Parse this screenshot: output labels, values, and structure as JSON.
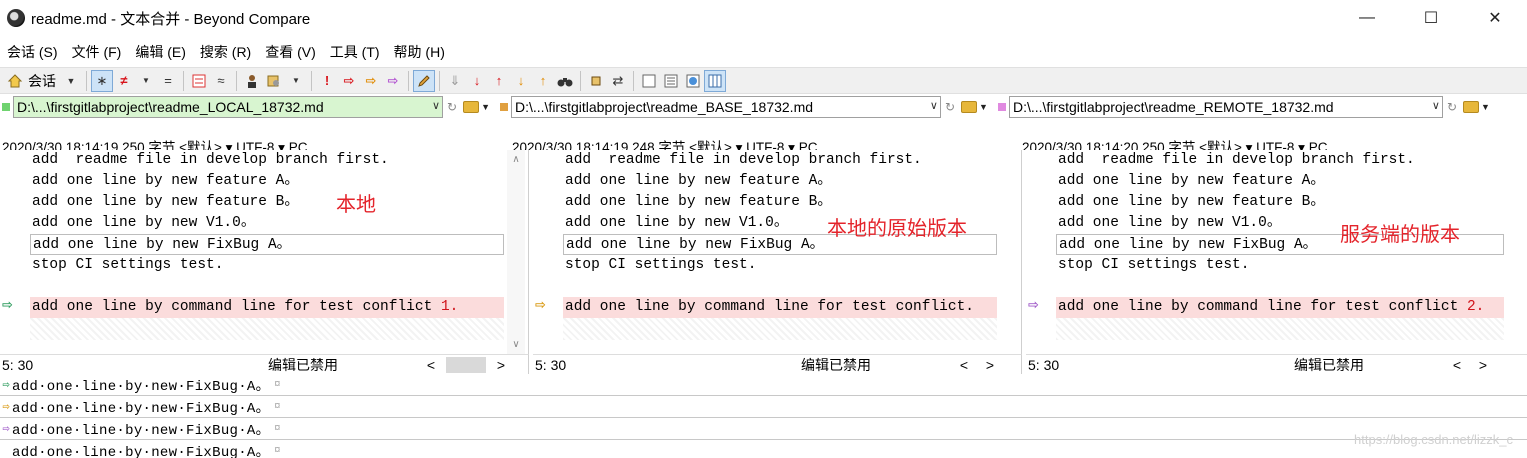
{
  "window": {
    "title": "readme.md - 文本合并 - Beyond Compare",
    "controls": {
      "minimize": "—",
      "maximize": "☐",
      "close": "✕"
    }
  },
  "menu": {
    "items": [
      "会话 (S)",
      "文件 (F)",
      "编辑 (E)",
      "搜索 (R)",
      "查看 (V)",
      "工具 (T)",
      "帮助 (H)"
    ]
  },
  "toolbar": {
    "session_label": "会话",
    "icons": {
      "all": "∗",
      "diffs": "≠",
      "same": "=",
      "context": "≈",
      "prev_conflict": "!",
      "next": "⇒",
      "swap": "⇄",
      "find": "🔍"
    }
  },
  "panes": [
    {
      "id": "local",
      "path": "D:\\...\\firstgitlabproject\\readme_LOCAL_18732.md",
      "path_bg": "#d8f5d0",
      "marker_color": "#6fd36f",
      "info": "2020/3/30 18:14:19   250 字节   <默认> ▾  UTF-8 ▾  PC",
      "annotation": "本地",
      "arrow_color": "#2f9d5f",
      "lines": [
        "add  readme file in develop branch first.",
        "add one line by new feature A。",
        "add one line by new feature B。",
        "add one line by new V1.0。",
        "add one line by new FixBug A。",
        "stop CI settings test.",
        ""
      ],
      "conflict_line": "add one line by command line for test conflict ",
      "conflict_suffix": "1.",
      "status_pos": "5: 30",
      "status_edit": "编辑已禁用"
    },
    {
      "id": "base",
      "path": "D:\\...\\firstgitlabproject\\readme_BASE_18732.md",
      "path_bg": "#ffffff",
      "marker_color": "#e0a040",
      "info": "2020/3/30 18:14:19   248 字节   <默认> ▾  UTF-8 ▾  PC",
      "annotation": "本地的原始版本",
      "arrow_color": "#d99a14",
      "lines": [
        "add  readme file in develop branch first.",
        "add one line by new feature A。",
        "add one line by new feature B。",
        "add one line by new V1.0。",
        "add one line by new FixBug A。",
        "stop CI settings test.",
        ""
      ],
      "conflict_line": "add one line by command line for test conflict.",
      "conflict_suffix": "",
      "status_pos": "5: 30",
      "status_edit": "编辑已禁用"
    },
    {
      "id": "remote",
      "path": "D:\\...\\firstgitlabproject\\readme_REMOTE_18732.md",
      "path_bg": "#ffffff",
      "marker_color": "#e08ae0",
      "info": "2020/3/30 18:14:20   250 字节   <默认> ▾  UTF-8 ▾  PC",
      "annotation": "服务端的版本",
      "arrow_color": "#a15cc9",
      "lines": [
        "add  readme file in develop branch first.",
        "add one line by new feature A。",
        "add one line by new feature B。",
        "add one line by new V1.0。",
        "add one line by new FixBug A。",
        "stop CI settings test.",
        ""
      ],
      "conflict_line": "add one line by command line for test conflict ",
      "conflict_suffix": "2.",
      "status_pos": "5: 30",
      "status_edit": "编辑已禁用"
    }
  ],
  "bottom_rows": [
    {
      "text": "add·one·line·by·new·FixBug·A。",
      "arrow": "⇨",
      "arrow_color": "#2f9d5f"
    },
    {
      "text": "add·one·line·by·new·FixBug·A。",
      "arrow": "⇨",
      "arrow_color": "#d99a14"
    },
    {
      "text": "add·one·line·by·new·FixBug·A。",
      "arrow": "⇨",
      "arrow_color": "#a15cc9"
    },
    {
      "text": "add·one·line·by·new·FixBug·A。",
      "arrow": "",
      "arrow_color": "#000000"
    }
  ],
  "bottom_pilcrow": "¤",
  "watermark": "https://blog.csdn.net/lizzk_c"
}
